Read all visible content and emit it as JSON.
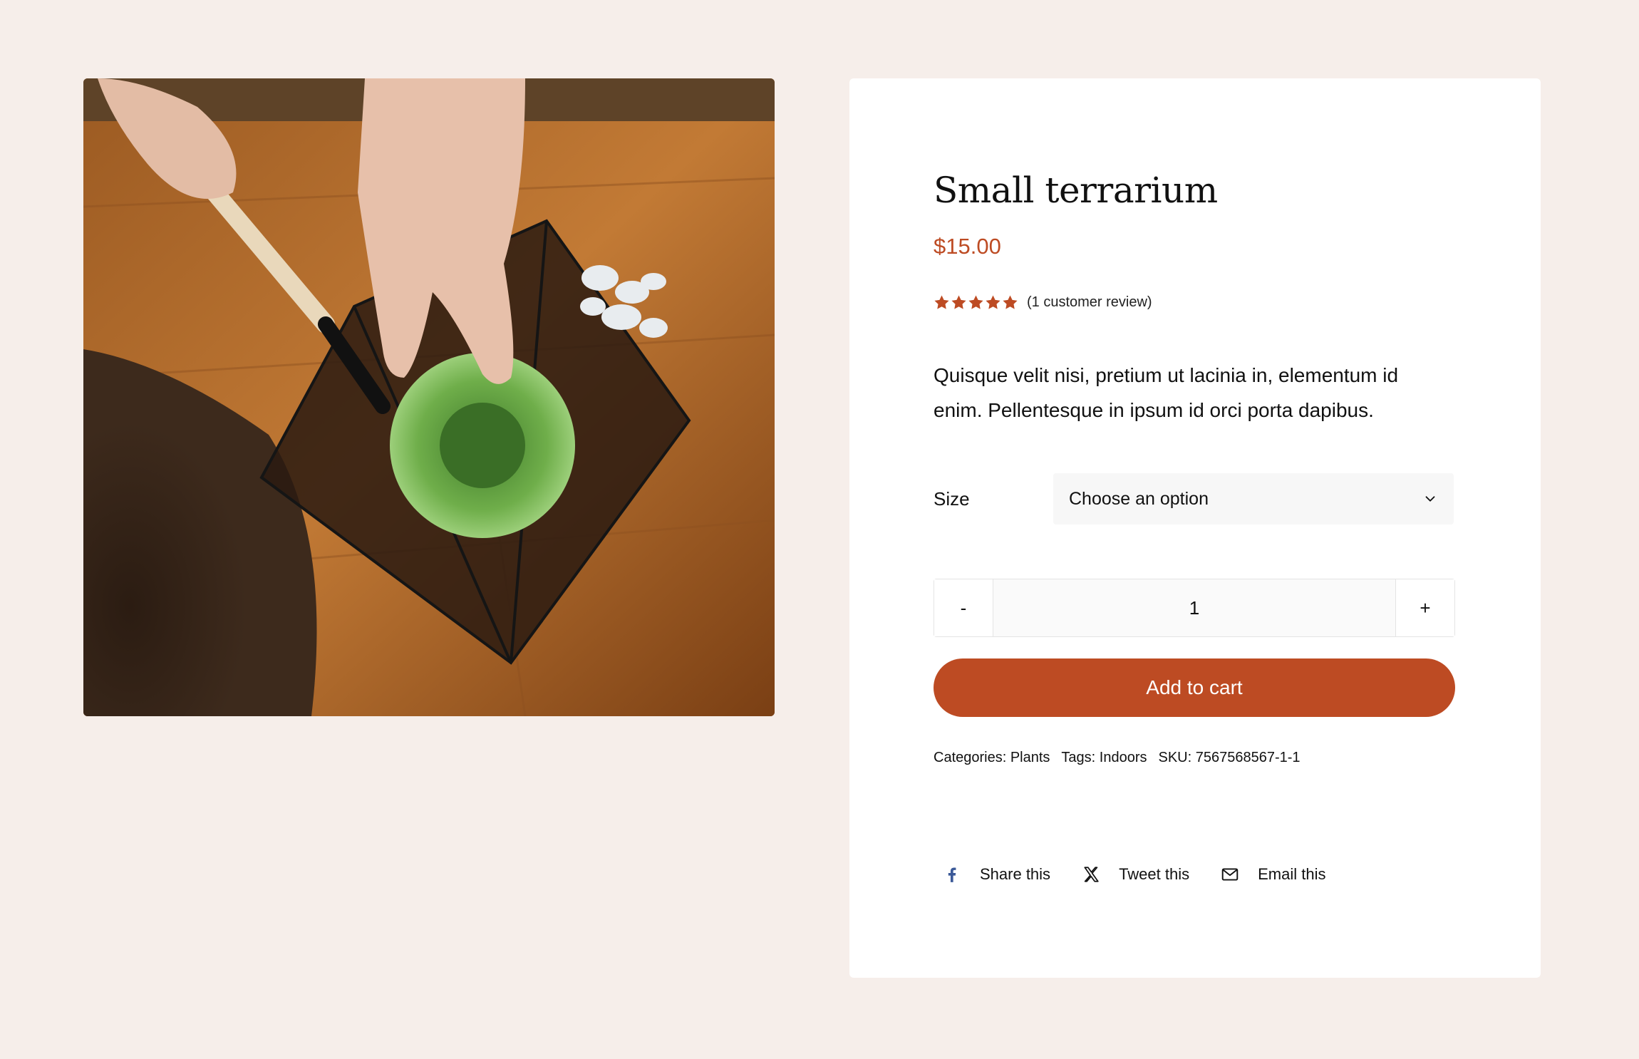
{
  "product": {
    "image_alt": "Hands planting a succulent in a glass pyramid terrarium",
    "title": "Small terrarium",
    "price": "$15.00",
    "rating": 5,
    "rating_max": 5,
    "review_text": "(1 customer review)",
    "description": "Quisque velit nisi, pretium ut lacinia in, elementum id enim. Pellentesque in ipsum id orci porta dapibus."
  },
  "variation": {
    "label": "Size",
    "selected": "Choose an option"
  },
  "quantity": {
    "minus": "-",
    "value": "1",
    "plus": "+"
  },
  "cart": {
    "button_label": "Add to cart"
  },
  "meta": {
    "categories": "Categories: Plants",
    "tags": "Tags: Indoors",
    "sku": "SKU: 7567568567-1-1"
  },
  "share": {
    "facebook": "Share this",
    "twitter": "Tweet this",
    "email": "Email this"
  },
  "colors": {
    "background": "#f6eeea",
    "accent": "#bd4b23",
    "card": "#ffffff",
    "facebook_blue": "#3b5998"
  },
  "icons": {
    "facebook": "facebook-icon",
    "twitter": "x-twitter-icon",
    "email": "envelope-icon",
    "dropdown": "chevron-down-icon",
    "star": "star-icon"
  }
}
